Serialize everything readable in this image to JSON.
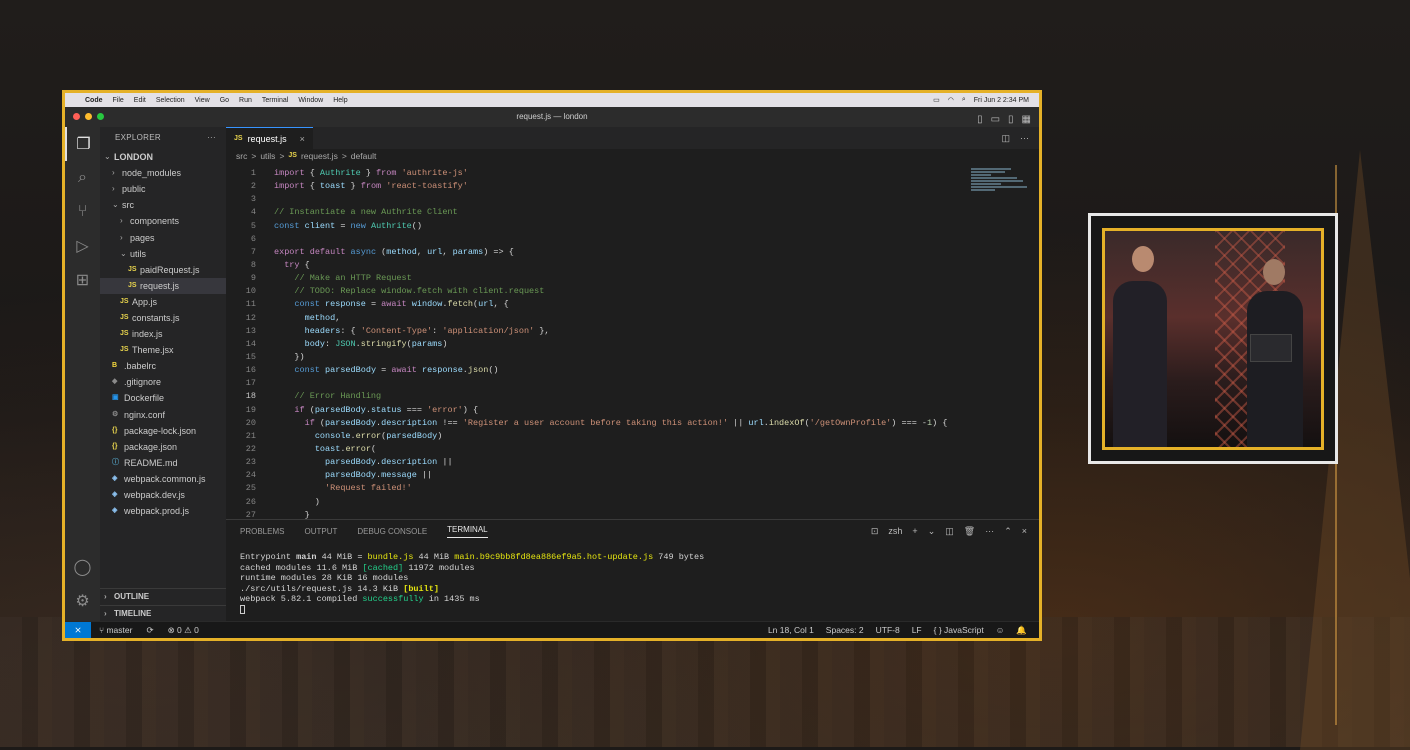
{
  "mac_menu": {
    "app": "Code",
    "items": [
      "File",
      "Edit",
      "Selection",
      "View",
      "Go",
      "Run",
      "Terminal",
      "Window",
      "Help"
    ],
    "clock": "Fri Jun 2  2:34 PM"
  },
  "window_title": "request.js — london",
  "explorer": {
    "title": "EXPLORER",
    "root": "LONDON",
    "rows": [
      {
        "label": "node_modules",
        "type": "folder",
        "depth": 1,
        "open": false
      },
      {
        "label": "public",
        "type": "folder",
        "depth": 1,
        "open": false
      },
      {
        "label": "src",
        "type": "folder",
        "depth": 1,
        "open": true
      },
      {
        "label": "components",
        "type": "folder",
        "depth": 2,
        "open": false
      },
      {
        "label": "pages",
        "type": "folder",
        "depth": 2,
        "open": false
      },
      {
        "label": "utils",
        "type": "folder",
        "depth": 2,
        "open": true
      },
      {
        "label": "paidRequest.js",
        "type": "js",
        "depth": 3
      },
      {
        "label": "request.js",
        "type": "js",
        "depth": 3,
        "selected": true
      },
      {
        "label": "App.js",
        "type": "js",
        "depth": 2
      },
      {
        "label": "constants.js",
        "type": "js",
        "depth": 2
      },
      {
        "label": "index.js",
        "type": "js",
        "depth": 2
      },
      {
        "label": "Theme.jsx",
        "type": "jsx",
        "depth": 2
      },
      {
        "label": ".babelrc",
        "type": "babel",
        "depth": 1
      },
      {
        "label": ".gitignore",
        "type": "git",
        "depth": 1
      },
      {
        "label": "Dockerfile",
        "type": "dock",
        "depth": 1
      },
      {
        "label": "nginx.conf",
        "type": "gear",
        "depth": 1
      },
      {
        "label": "package-lock.json",
        "type": "json",
        "depth": 1
      },
      {
        "label": "package.json",
        "type": "json",
        "depth": 1
      },
      {
        "label": "README.md",
        "type": "info",
        "depth": 1
      },
      {
        "label": "webpack.common.js",
        "type": "web",
        "depth": 1
      },
      {
        "label": "webpack.dev.js",
        "type": "web",
        "depth": 1
      },
      {
        "label": "webpack.prod.js",
        "type": "web",
        "depth": 1
      }
    ],
    "outline": "OUTLINE",
    "timeline": "TIMELINE"
  },
  "tab": {
    "label": "request.js"
  },
  "breadcrumbs": [
    "src",
    ">",
    "utils",
    ">",
    "request.js",
    ">",
    "default"
  ],
  "code": [
    "import { Authrite } from 'authrite-js'",
    "import { toast } from 'react-toastify'",
    "",
    "// Instantiate a new Authrite Client",
    "const client = new Authrite()",
    "",
    "export default async (method, url, params) => {",
    "  try {",
    "    // Make an HTTP Request",
    "    // TODO: Replace window.fetch with client.request",
    "    const response = await window.fetch(url, {",
    "      method,",
    "      headers: { 'Content-Type': 'application/json' },",
    "      body: JSON.stringify(params)",
    "    })",
    "    const parsedBody = await response.json()",
    "",
    "    // Error Handling",
    "    if (parsedBody.status === 'error') {",
    "      if (parsedBody.description !== 'Register a user account before taking this action!' || url.indexOf('/getOwnProfile') === -1) {",
    "        console.error(parsedBody)",
    "        toast.error(",
    "          parsedBody.description ||",
    "          parsedBody.message ||",
    "          'Request failed!'",
    "        )",
    "      }"
  ],
  "current_line": 18,
  "panel": {
    "tabs": [
      "PROBLEMS",
      "OUTPUT",
      "DEBUG CONSOLE",
      "TERMINAL"
    ],
    "active": "TERMINAL",
    "shell": "zsh"
  },
  "terminal": [
    "Entrypoint main 44 MiB = bundle.js 44 MiB main.b9c9bb8fd8ea886ef9a5.hot-update.js 749 bytes",
    "cached modules 11.6 MiB [cached] 11972 modules",
    "runtime modules 28 KiB 16 modules",
    "./src/utils/request.js 14.3 KiB [built]",
    "webpack 5.82.1 compiled successfully in 1435 ms"
  ],
  "status": {
    "branch": "master",
    "problems": "⊗ 0 ⚠ 0",
    "position": "Ln 18, Col 1",
    "spaces": "Spaces: 2",
    "encoding": "UTF-8",
    "eol": "LF",
    "language": "{ } JavaScript"
  },
  "colors": {
    "accent": "#e5b128",
    "keyword": "#569cd6",
    "control": "#c586c0",
    "string": "#ce9178",
    "comment": "#6a9955",
    "variable": "#9cdcfe",
    "function": "#dcdcaa",
    "class": "#4ec9b0",
    "number": "#b5cea8"
  }
}
